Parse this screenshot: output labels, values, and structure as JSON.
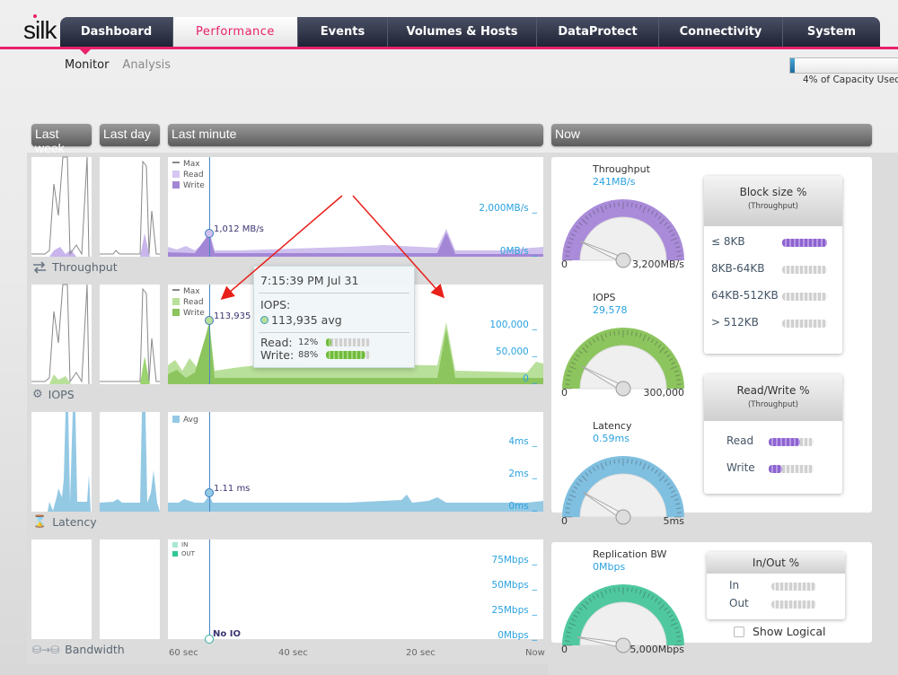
{
  "app": {
    "logo": "silk"
  },
  "nav": {
    "tabs": [
      {
        "label": "Dashboard",
        "active": false
      },
      {
        "label": "Performance",
        "active": true
      },
      {
        "label": "Events",
        "active": false
      },
      {
        "label": "Volumes & Hosts",
        "active": false
      },
      {
        "label": "DataProtect",
        "active": false
      },
      {
        "label": "Connectivity",
        "active": false
      },
      {
        "label": "System",
        "active": false
      }
    ],
    "accent_color": "#e8216a"
  },
  "subnav": {
    "items": [
      {
        "label": "Monitor",
        "active": true
      },
      {
        "label": "Analysis",
        "active": false
      }
    ]
  },
  "capacity": {
    "percent_used": 4,
    "label": "4% of Capacity Used"
  },
  "range_headers": {
    "last_week": "Last week",
    "last_day": "Last day",
    "last_minute": "Last minute",
    "now": "Now"
  },
  "rows": {
    "throughput": {
      "label": "Throughput",
      "legend": [
        "Max",
        "Read",
        "Write"
      ],
      "axis": [
        "2,000MB/s",
        "0MB/s"
      ],
      "point_label": "1,012 MB/s",
      "color": "#b59de0"
    },
    "iops": {
      "label": "IOPS",
      "legend": [
        "Max",
        "Read",
        "Write"
      ],
      "axis": [
        "100,000",
        "50,000",
        "0"
      ],
      "point_label": "113,935",
      "color": "#9bd36f"
    },
    "latency": {
      "label": "Latency",
      "legend": [
        "Avg"
      ],
      "axis": [
        "4ms",
        "2ms",
        "0ms"
      ],
      "point_label": "1.11 ms",
      "color": "#94c9e4"
    },
    "bandwidth": {
      "label": "Bandwidth",
      "legend": [
        "IN",
        "OUT"
      ],
      "axis": [
        "75Mbps",
        "50Mbps",
        "25Mbps",
        "0Mbps"
      ],
      "point_label": "No IO",
      "color": "#5fd1b3"
    }
  },
  "x_axis": [
    "60 sec",
    "40 sec",
    "20 sec",
    "Now"
  ],
  "tooltip": {
    "time": "7:15:39 PM Jul 31",
    "metric": "IOPS:",
    "value": "113,935 avg",
    "read_label": "Read:",
    "read_pct": "12%",
    "read_fraction": 0.12,
    "write_label": "Write:",
    "write_pct": "88%",
    "write_fraction": 0.88
  },
  "gauges": [
    {
      "title": "Throughput",
      "value": "241MB/s",
      "min": "0",
      "max": "3,200MB/s",
      "fraction": 0.075,
      "color": "#a98bd9"
    },
    {
      "title": "IOPS",
      "value": "29,578",
      "min": "0",
      "max": "300,000",
      "fraction": 0.099,
      "color": "#8cc45e"
    },
    {
      "title": "Latency",
      "value": "0.59ms",
      "min": "0",
      "max": "5ms",
      "fraction": 0.118,
      "color": "#7fbfe0"
    },
    {
      "title": "Replication BW",
      "value": "0Mbps",
      "min": "0",
      "max": "5,000Mbps",
      "fraction": 0.0,
      "color": "#4fc8a0"
    }
  ],
  "block_size": {
    "title": "Block size %",
    "subtitle": "(Throughput)",
    "items": [
      {
        "label": "≤ 8KB",
        "fraction": 1.0
      },
      {
        "label": "8KB-64KB",
        "fraction": 0.0
      },
      {
        "label": "64KB-512KB",
        "fraction": 0.0
      },
      {
        "label": "> 512KB",
        "fraction": 0.0
      }
    ]
  },
  "read_write": {
    "title": "Read/Write %",
    "subtitle": "(Throughput)",
    "items": [
      {
        "label": "Read",
        "fraction": 0.7
      },
      {
        "label": "Write",
        "fraction": 0.3
      }
    ]
  },
  "in_out": {
    "title": "In/Out %",
    "items": [
      {
        "label": "In",
        "fraction": 0.0
      },
      {
        "label": "Out",
        "fraction": 0.0
      }
    ]
  },
  "show_logical": {
    "label": "Show Logical",
    "checked": false
  }
}
